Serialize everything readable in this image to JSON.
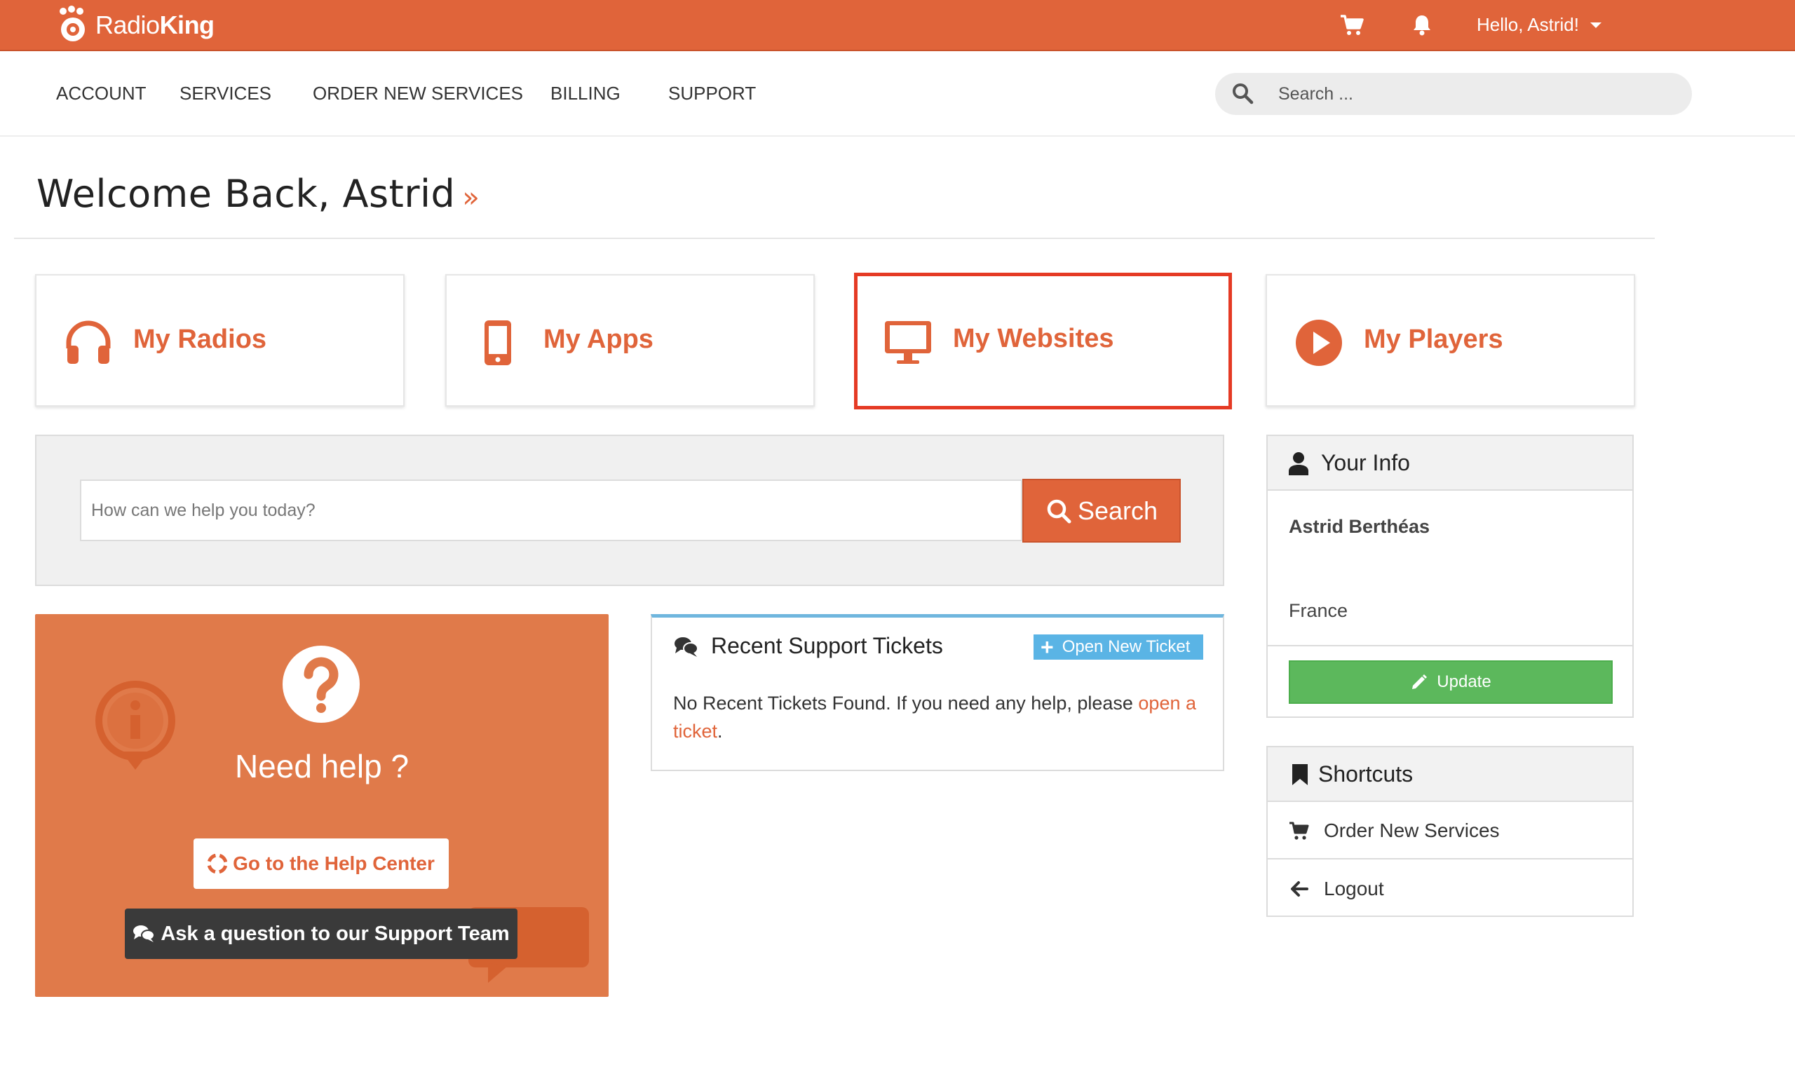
{
  "brand": {
    "name_light": "Radio",
    "name_bold": "King"
  },
  "topbar": {
    "greeting": "Hello, Astrid!"
  },
  "nav": {
    "items": [
      "ACCOUNT",
      "SERVICES",
      "ORDER NEW SERVICES",
      "BILLING",
      "SUPPORT"
    ],
    "search_placeholder": "Search ..."
  },
  "welcome": {
    "title": "Welcome Back, Astrid",
    "suffix": "»"
  },
  "tiles": [
    {
      "label": "My Radios",
      "icon": "headphones-icon"
    },
    {
      "label": "My Apps",
      "icon": "mobile-icon"
    },
    {
      "label": "My Websites",
      "icon": "desktop-icon"
    },
    {
      "label": "My Players",
      "icon": "play-circle-icon"
    }
  ],
  "help_search": {
    "placeholder": "How can we help you today?",
    "button_label": "Search"
  },
  "need_help": {
    "title": "Need help ?",
    "help_center_label": "Go to the Help Center",
    "ask_label": "Ask a question to our Support Team"
  },
  "tickets": {
    "title": "Recent Support Tickets",
    "open_label": "Open New Ticket",
    "empty_text": "No Recent Tickets Found. If you need any help, please ",
    "link_text": "open a ticket",
    "end_text": "."
  },
  "your_info": {
    "title": "Your Info",
    "name": "Astrid Berthéas",
    "country": "France",
    "update_label": "Update"
  },
  "shortcuts": {
    "title": "Shortcuts",
    "items": [
      {
        "label": "Order New Services",
        "icon": "cart-icon"
      },
      {
        "label": "Logout",
        "icon": "arrow-left-icon"
      }
    ]
  },
  "colors": {
    "brand": "#e0643a",
    "highlight": "#e53a24",
    "success": "#5cb85c",
    "info": "#5ab4e5"
  }
}
